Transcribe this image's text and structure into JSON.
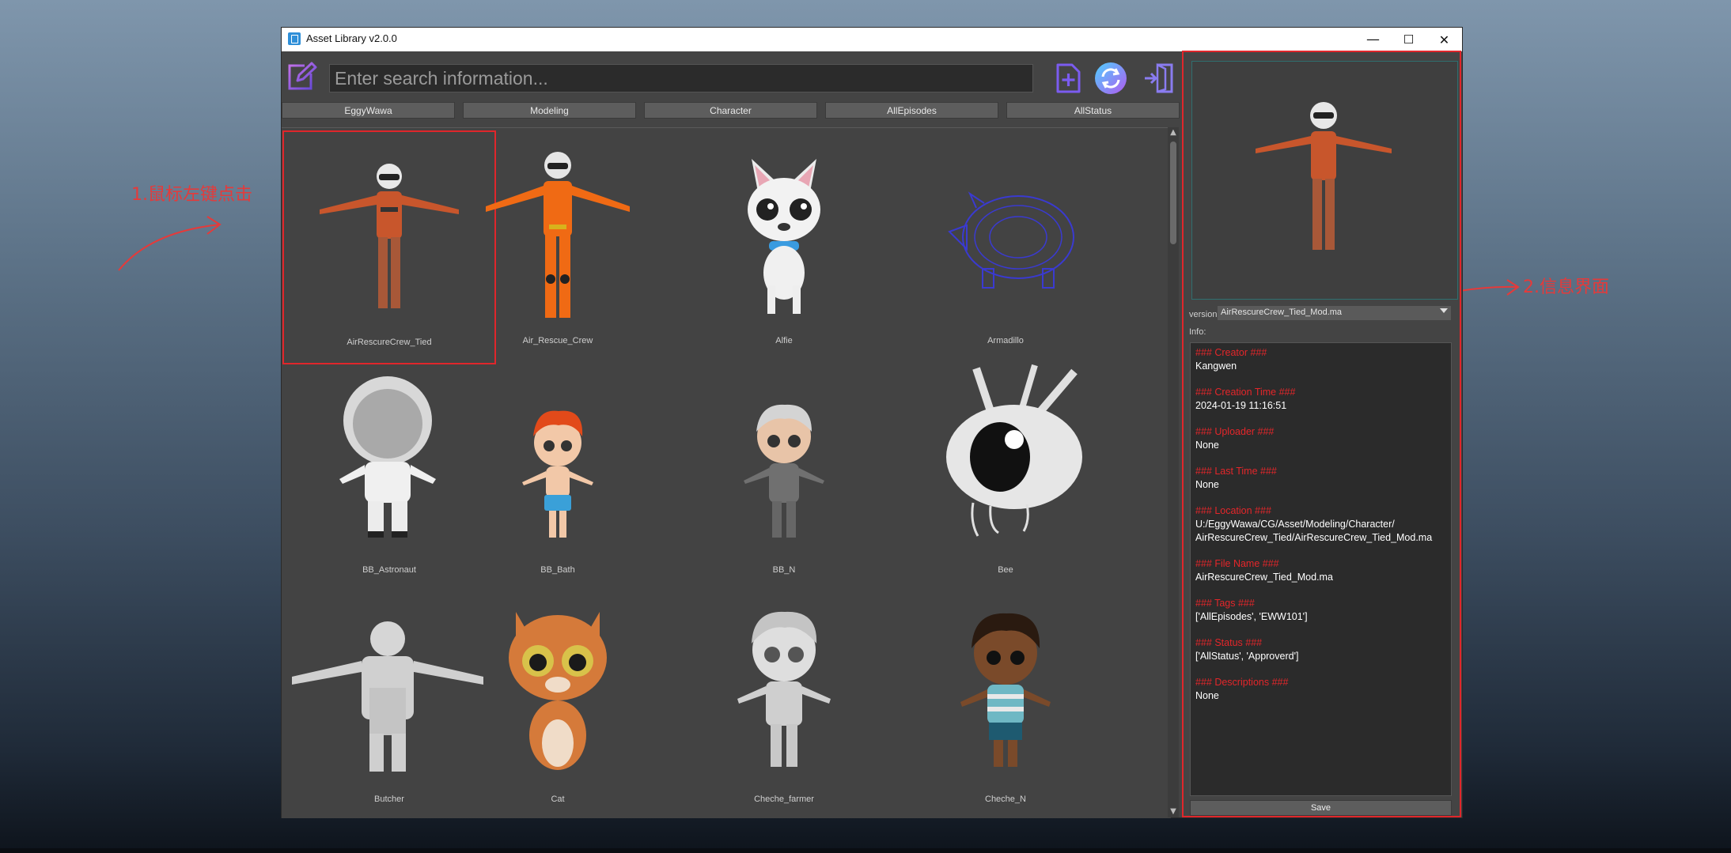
{
  "window": {
    "title": "Asset Library v2.0.0"
  },
  "toolbar": {
    "search_placeholder": "Enter search information..."
  },
  "filters": [
    "EggyWawa",
    "Modeling",
    "Character",
    "AllEpisodes",
    "AllStatus"
  ],
  "assets": [
    "AirRescureCrew_Tied",
    "Air_Rescue_Crew",
    "Alfie",
    "Armadillo",
    "BB_Astronaut",
    "BB_Bath",
    "BB_N",
    "Bee",
    "Butcher",
    "Cat",
    "Cheche_farmer",
    "Cheche_N"
  ],
  "selected_asset": "AirRescureCrew_Tied",
  "panel": {
    "version_label": "version:",
    "version_value": "AirRescureCrew_Tied_Mod.ma",
    "info_label": "Info:",
    "save_label": "Save",
    "info": [
      {
        "h": "### Creator ###",
        "v": [
          "Kangwen"
        ]
      },
      {
        "h": "### Creation Time ###",
        "v": [
          "2024-01-19 11:16:51"
        ]
      },
      {
        "h": "### Uploader ###",
        "v": [
          "None"
        ]
      },
      {
        "h": "### Last Time ###",
        "v": [
          "None"
        ]
      },
      {
        "h": "### Location ###",
        "v": [
          "U:/EggyWawa/CG/Asset/Modeling/Character/",
          "AirRescureCrew_Tied/AirRescureCrew_Tied_Mod.ma"
        ]
      },
      {
        "h": "### File Name ###",
        "v": [
          "AirRescureCrew_Tied_Mod.ma"
        ]
      },
      {
        "h": "### Tags ###",
        "v": [
          "['AllEpisodes', 'EWW101']"
        ]
      },
      {
        "h": "### Status ###",
        "v": [
          "['AllStatus', 'Approverd']"
        ]
      },
      {
        "h": "### Descriptions ###",
        "v": [
          "None"
        ]
      }
    ]
  },
  "annotations": {
    "step1": "1.鼠标左键点击",
    "step2": "2.信息界面"
  },
  "colors": {
    "accent_red": "#e0262b",
    "panel_bg": "#444444"
  }
}
